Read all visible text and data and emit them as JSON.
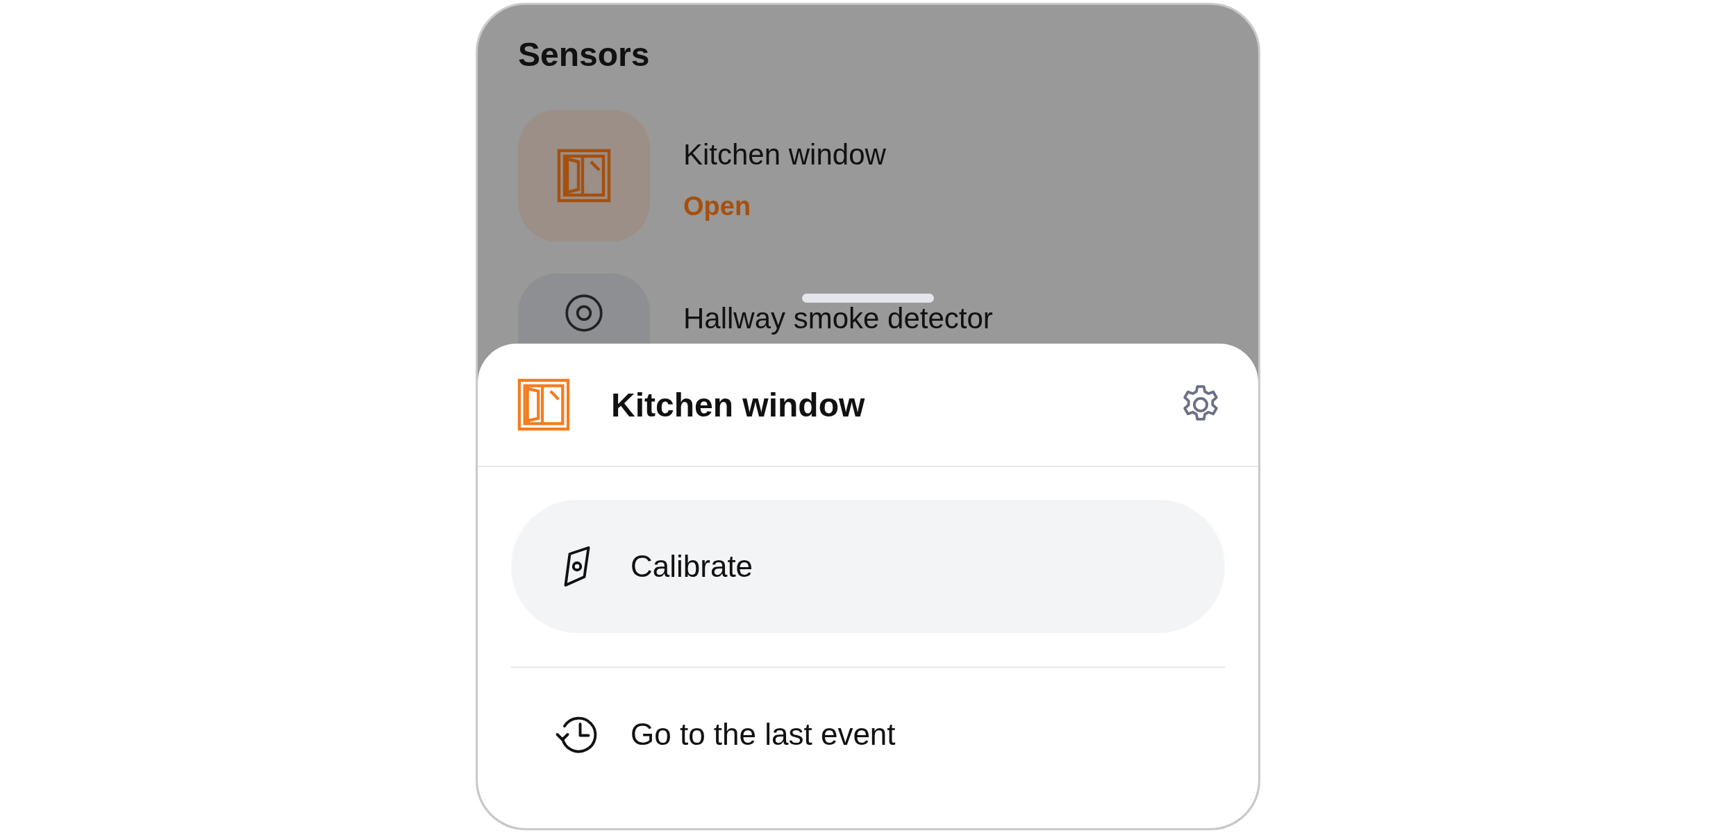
{
  "screen": {
    "title": "Sensors"
  },
  "sensors": [
    {
      "name": "Kitchen window",
      "status": "Open",
      "kind": "window"
    },
    {
      "name": "Hallway smoke detector",
      "kind": "smoke"
    }
  ],
  "sheet": {
    "title": "Kitchen window",
    "kind": "window",
    "actions": [
      {
        "label": "Calibrate",
        "kind": "calibrate",
        "selected": true
      },
      {
        "label": "Go to the last event",
        "kind": "history",
        "selected": false
      }
    ]
  }
}
